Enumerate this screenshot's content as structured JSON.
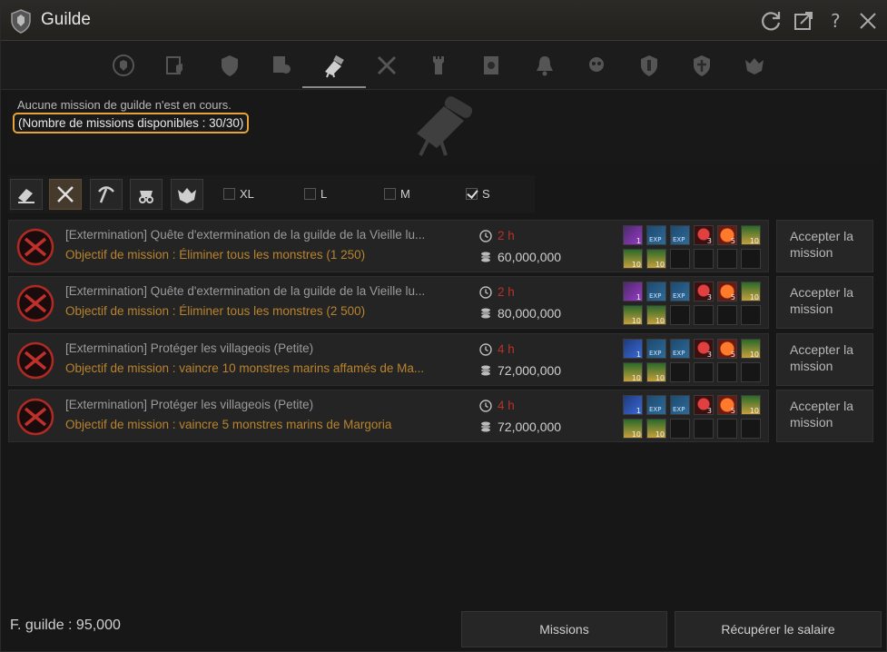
{
  "window": {
    "title": "Guilde"
  },
  "status": {
    "no_mission": "Aucune mission de guilde n'est en cours.",
    "available": "(Nombre de missions disponibles : 30/30)"
  },
  "filters": {
    "sizes": [
      {
        "label": "XL",
        "checked": false
      },
      {
        "label": "L",
        "checked": false
      },
      {
        "label": "M",
        "checked": false
      },
      {
        "label": "S",
        "checked": true
      }
    ]
  },
  "missions": [
    {
      "title": "[Extermination] Quête d'extermination de la guilde de la Vieille lu...",
      "objective": "Objectif de mission : Éliminer tous les monstres (1 250)",
      "time": "2 h",
      "reward_money": "60,000,000",
      "accept_label": "Accepter la mission",
      "items": [
        {
          "icon": "purple-scroll-icon",
          "qty": "1"
        },
        {
          "icon": "exp-scroll-icon",
          "qty": "EXP"
        },
        {
          "icon": "exp-scroll-icon",
          "qty": "EXP"
        },
        {
          "icon": "red-crystal-icon",
          "qty": "3"
        },
        {
          "icon": "fire-orb-icon",
          "qty": "5"
        },
        {
          "icon": "potion-icon",
          "qty": "10"
        },
        {
          "icon": "potion-icon",
          "qty": "10"
        },
        {
          "icon": "potion-icon",
          "qty": "10"
        }
      ]
    },
    {
      "title": "[Extermination] Quête d'extermination de la guilde de la Vieille lu...",
      "objective": "Objectif de mission : Éliminer tous les monstres (2 500)",
      "time": "2 h",
      "reward_money": "80,000,000",
      "accept_label": "Accepter la mission",
      "items": [
        {
          "icon": "purple-scroll-icon",
          "qty": "1"
        },
        {
          "icon": "exp-scroll-icon",
          "qty": "EXP"
        },
        {
          "icon": "exp-scroll-icon",
          "qty": "EXP"
        },
        {
          "icon": "red-crystal-icon",
          "qty": "3"
        },
        {
          "icon": "fire-orb-icon",
          "qty": "5"
        },
        {
          "icon": "potion-icon",
          "qty": "10"
        },
        {
          "icon": "potion-icon",
          "qty": "10"
        },
        {
          "icon": "potion-icon",
          "qty": "10"
        }
      ]
    },
    {
      "title": "[Extermination] Protéger les villageois (Petite)",
      "objective": "Objectif de mission : vaincre 10 monstres marins affamés de Ma...",
      "time": "4 h",
      "reward_money": "72,000,000",
      "accept_label": "Accepter la mission",
      "items": [
        {
          "icon": "blue-scroll-icon",
          "qty": "1"
        },
        {
          "icon": "exp-scroll-icon",
          "qty": "EXP"
        },
        {
          "icon": "exp-scroll-icon",
          "qty": "EXP"
        },
        {
          "icon": "red-crystal-icon",
          "qty": "3"
        },
        {
          "icon": "fire-orb-icon",
          "qty": "5"
        },
        {
          "icon": "potion-icon",
          "qty": "10"
        },
        {
          "icon": "potion-icon",
          "qty": "10"
        },
        {
          "icon": "potion-icon",
          "qty": "10"
        }
      ]
    },
    {
      "title": "[Extermination] Protéger les villageois (Petite)",
      "objective": "Objectif de mission : vaincre 5 monstres marins de Margoria",
      "time": "4 h",
      "reward_money": "72,000,000",
      "accept_label": "Accepter la mission",
      "items": [
        {
          "icon": "blue-scroll-icon",
          "qty": "1"
        },
        {
          "icon": "exp-scroll-icon",
          "qty": "EXP"
        },
        {
          "icon": "exp-scroll-icon",
          "qty": "EXP"
        },
        {
          "icon": "red-crystal-icon",
          "qty": "3"
        },
        {
          "icon": "fire-orb-icon",
          "qty": "5"
        },
        {
          "icon": "potion-icon",
          "qty": "10"
        },
        {
          "icon": "potion-icon",
          "qty": "10"
        },
        {
          "icon": "potion-icon",
          "qty": "10"
        }
      ]
    }
  ],
  "footer": {
    "guild_funds": "F. guilde : 95,000",
    "missions_button": "Missions",
    "salary_button": "Récupérer le salaire"
  },
  "colors": {
    "highlight_border": "#e8a23a",
    "objective_text": "#b8832e",
    "time_text": "#b8322a"
  }
}
